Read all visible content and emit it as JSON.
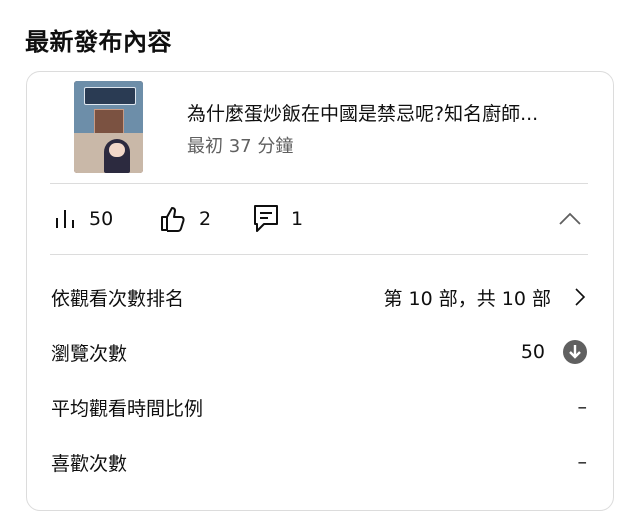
{
  "section_title": "最新發布內容",
  "video": {
    "title": "為什麼蛋炒飯在中國是禁忌呢?知名廚師...",
    "subtitle": "最初 37 分鐘"
  },
  "stats": {
    "views": "50",
    "likes": "2",
    "comments": "1"
  },
  "metrics": [
    {
      "label": "依觀看次數排名",
      "value": "第 10 部，共 10 部",
      "icon": "chevron-right-icon"
    },
    {
      "label": "瀏覽次數",
      "value": "50",
      "icon": "arrow-down-circle-icon"
    },
    {
      "label": "平均觀看時間比例",
      "value": "–"
    },
    {
      "label": "喜歡次數",
      "value": "–"
    }
  ],
  "colors": {
    "text": "#0f0f0f",
    "secondary_text": "#606060",
    "border": "#dcdcdc",
    "down_badge": "#606060"
  }
}
